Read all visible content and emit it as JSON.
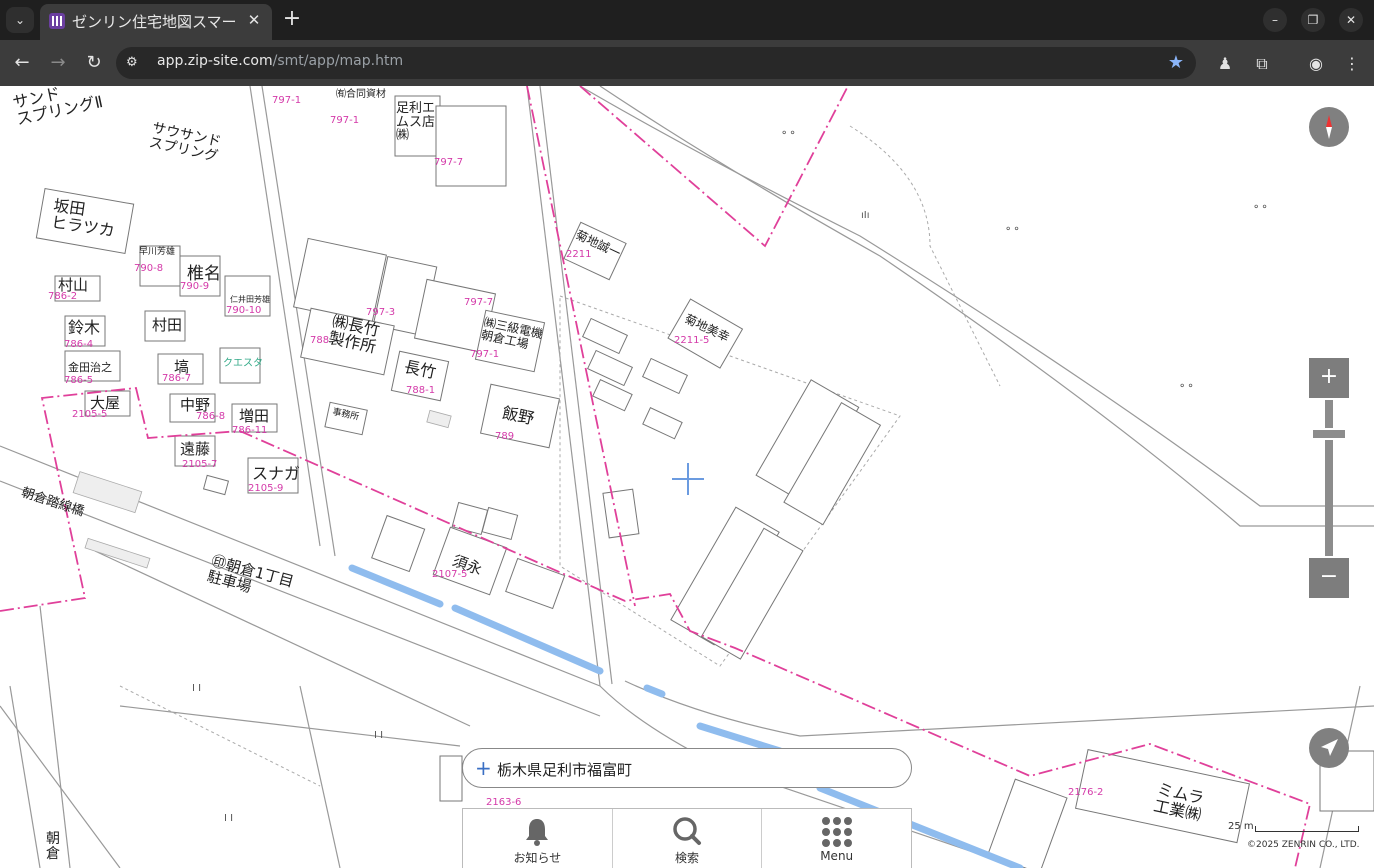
{
  "browser": {
    "tab_title": "ゼンリン住宅地図スマー",
    "url_domain": "app.zip-site.com",
    "url_path": "/smt/app/map.htm"
  },
  "map": {
    "labels": [
      {
        "id": "lbl-sand2",
        "text": "サンド\nスプリングⅡ"
      },
      {
        "id": "lbl-sand",
        "text": "サウサンド\nスプリング"
      },
      {
        "id": "lbl-sakata",
        "text": "坂田\nヒラツカ"
      },
      {
        "id": "lbl-murayama",
        "text": "村山"
      },
      {
        "id": "lbl-suzuki",
        "text": "鈴木"
      },
      {
        "id": "lbl-kaneda",
        "text": "金田治之"
      },
      {
        "id": "lbl-ooya",
        "text": "大屋"
      },
      {
        "id": "lbl-hayakawa",
        "text": "早川芳雄"
      },
      {
        "id": "lbl-shiina",
        "text": "椎名"
      },
      {
        "id": "lbl-niida",
        "text": "仁井田芳雄"
      },
      {
        "id": "lbl-murata",
        "text": "村田"
      },
      {
        "id": "lbl-tsubo",
        "text": "塙"
      },
      {
        "id": "lbl-questa",
        "text": "クエスタ"
      },
      {
        "id": "lbl-nakano",
        "text": "中野"
      },
      {
        "id": "lbl-masuda",
        "text": "増田"
      },
      {
        "id": "lbl-endo",
        "text": "遠藤"
      },
      {
        "id": "lbl-sunaga",
        "text": "スナガ"
      },
      {
        "id": "lbl-ashikaga",
        "text": "足利エムス店㈱"
      },
      {
        "id": "lbl-awase",
        "text": "㈲合同資材"
      },
      {
        "id": "lbl-nagatake-seisaku",
        "text": "㈱長竹\n製作所"
      },
      {
        "id": "lbl-nagatake",
        "text": "長竹"
      },
      {
        "id": "lbl-jimusho",
        "text": "事務所"
      },
      {
        "id": "lbl-iino",
        "text": "飯野"
      },
      {
        "id": "lbl-sanko",
        "text": "㈱三級電機\n朝倉工場"
      },
      {
        "id": "lbl-kikuchi1",
        "text": "菊地誠一"
      },
      {
        "id": "lbl-kikuchi2",
        "text": "菊地美幸"
      },
      {
        "id": "lbl-susumu",
        "text": "須永"
      },
      {
        "id": "lbl-chusha",
        "text": "㊞朝倉1丁目\n駐車場"
      },
      {
        "id": "lbl-bridge",
        "text": "朝倉踏線橋"
      },
      {
        "id": "lbl-mimura",
        "text": "ミムラ\n工業㈱"
      },
      {
        "id": "lbl-asakura",
        "text": "朝\n倉"
      }
    ],
    "lot_numbers": [
      "797-1",
      "797-1",
      "797-7",
      "790-8",
      "790-9",
      "790-10",
      "786-2",
      "786-4",
      "786-5",
      "2105-5",
      "786-7",
      "786-8",
      "786-11",
      "2105-7",
      "2105-9",
      "797-3",
      "797-7",
      "797-1",
      "788",
      "788-1",
      "789",
      "2211",
      "2211-5",
      "2107-5",
      "2176-2",
      "2163-6"
    ],
    "search_address": "栃木県足利市福富町",
    "scale_label": "25 m",
    "copyright": "©2025 ZENRIN CO., LTD."
  },
  "nav": {
    "items": [
      {
        "label": "お知らせ",
        "icon": "bell-icon"
      },
      {
        "label": "検索",
        "icon": "search-icon"
      },
      {
        "label": "Menu",
        "icon": "grid-menu-icon"
      }
    ]
  },
  "controls": {
    "zoom_in": "+",
    "zoom_out": "−",
    "zoom_level": 0.22
  },
  "colors": {
    "boundary": "#e0409a",
    "water": "#8fbcee",
    "lot_number": "#d43aa9"
  }
}
